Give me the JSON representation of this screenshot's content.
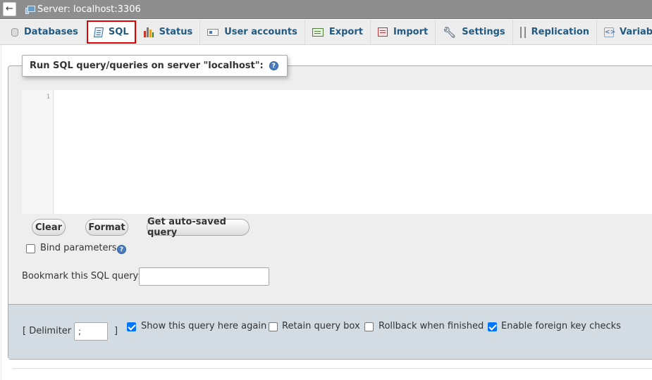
{
  "topbar": {
    "back_label": "←",
    "server_label": "Server: localhost:3306"
  },
  "tabs": [
    {
      "id": "databases",
      "label": "Databases",
      "icon": "database-icon",
      "active": false
    },
    {
      "id": "sql",
      "label": "SQL",
      "icon": "sql-icon",
      "active": true
    },
    {
      "id": "status",
      "label": "Status",
      "icon": "status-chart-icon",
      "active": false
    },
    {
      "id": "user-accounts",
      "label": "User accounts",
      "icon": "user-accounts-icon",
      "active": false
    },
    {
      "id": "export",
      "label": "Export",
      "icon": "export-icon",
      "active": false
    },
    {
      "id": "import",
      "label": "Import",
      "icon": "import-icon",
      "active": false
    },
    {
      "id": "settings",
      "label": "Settings",
      "icon": "wrench-icon",
      "active": false
    },
    {
      "id": "replication",
      "label": "Replication",
      "icon": "replication-icon",
      "active": false
    },
    {
      "id": "variables",
      "label": "Variables",
      "icon": "variables-icon",
      "active": false
    }
  ],
  "query_panel": {
    "legend": "Run SQL query/queries on server \"localhost\":",
    "editor": {
      "line_numbers": [
        "1"
      ],
      "value": ""
    },
    "buttons": {
      "clear": "Clear",
      "format": "Format",
      "autosaved": "Get auto-saved query"
    },
    "bind_parameters": {
      "label": "Bind parameters",
      "checked": false
    },
    "bookmark": {
      "label": "Bookmark this SQL query:",
      "value": ""
    }
  },
  "options": {
    "delimiter_open": "[ Delimiter",
    "delimiter_value": ";",
    "delimiter_close": "]",
    "show_query_again": {
      "label": "Show this query here again",
      "checked": true
    },
    "retain_query_box": {
      "label": "Retain query box",
      "checked": false
    },
    "rollback": {
      "label": "Rollback when finished",
      "checked": false
    },
    "foreign_key_checks": {
      "label": "Enable foreign key checks",
      "checked": true
    }
  },
  "colors": {
    "tab_text": "#235a81",
    "active_highlight": "#e10000",
    "topbar": "#8e8e8e",
    "options_band": "#d3dce3",
    "checkbox_checked": "#0075ff"
  }
}
